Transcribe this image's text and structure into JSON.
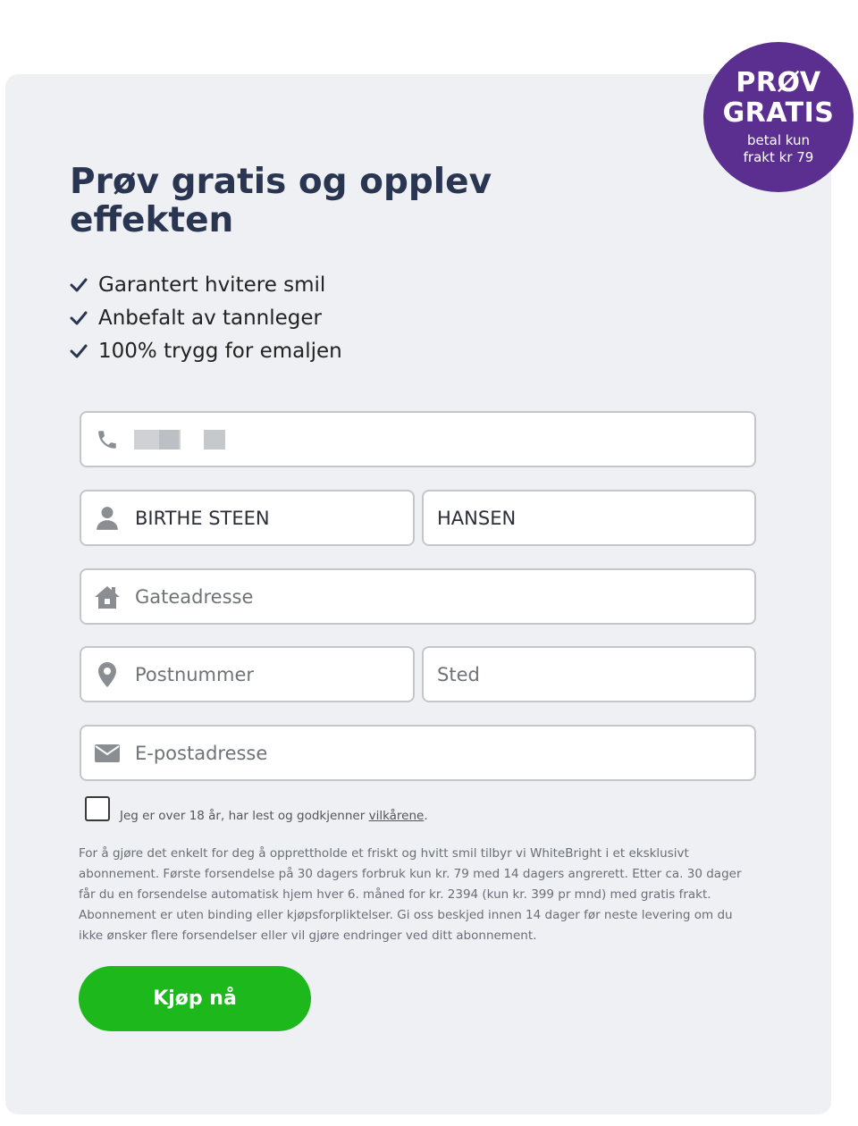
{
  "badge": {
    "line1": "PRØV",
    "line2": "GRATIS",
    "line3": "betal kun",
    "line4": "frakt kr 79",
    "color": "#5a2f8f"
  },
  "title": "Prøv gratis og opplev effekten",
  "benefits": [
    "Garantert hvitere smil",
    "Anbefalt av tannleger",
    "100% trygg for emaljen"
  ],
  "form": {
    "phone": {
      "value": "",
      "icon": "phone-icon"
    },
    "first_name": {
      "value": "BIRTHE STEEN",
      "icon": "user-icon"
    },
    "last_name": {
      "value": "HANSEN"
    },
    "street": {
      "placeholder": "Gateadresse",
      "icon": "home-icon"
    },
    "postal_code": {
      "placeholder": "Postnummer",
      "icon": "location-pin-icon"
    },
    "city": {
      "placeholder": "Sted"
    },
    "email": {
      "placeholder": "E-postadresse",
      "icon": "envelope-icon"
    }
  },
  "consent": {
    "text": "Jeg er over 18 år, har lest og godkjenner ",
    "link": "vilkårene",
    "after": ".",
    "checked": false
  },
  "terms": "For å gjøre det enkelt for deg å opprettholde et friskt og hvitt smil tilbyr vi WhiteBright i et eksklusivt abonnement. Første forsendelse på 30 dagers forbruk kun kr. 79 med 14 dagers angrerett. Etter ca. 30 dager får du en forsendelse automatisk hjem hver 6. måned for kr. 2394 (kun kr. 399 pr mnd) med gratis frakt. Abonnement er uten binding eller kjøpsforpliktelser. Gi oss beskjed innen 14 dager før neste levering om du ikke ønsker flere forsendelser eller vil gjøre endringer ved ditt abonnement.",
  "buy_button": {
    "label": "Kjøp nå",
    "color": "#1cb81c"
  }
}
